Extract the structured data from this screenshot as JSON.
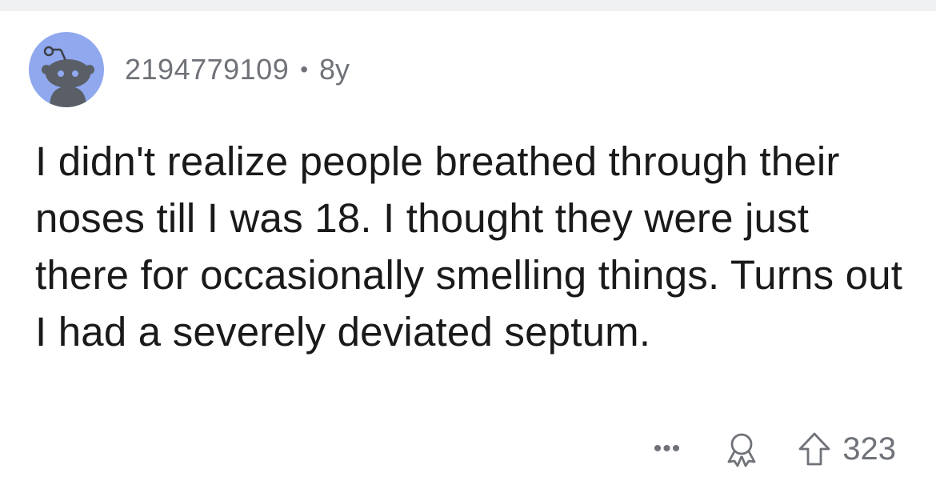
{
  "comment": {
    "username": "2194779109",
    "separator": "•",
    "age": "8y",
    "text": "I didn't realize people breathed through their noses till I was 18. I thought they were just there for occasionally smelling things. Turns out I had a severely deviated septum.",
    "score": "323"
  },
  "actions": {
    "more_label": "•••"
  },
  "icons": {
    "avatar": "snoo-avatar-icon",
    "more": "more-options-icon",
    "award": "award-icon",
    "upvote": "upvote-arrow-icon"
  },
  "colors": {
    "avatar_bg": "#8fa8ee",
    "meta_text": "#6f7278",
    "body_text": "#1a1a1b",
    "top_strip": "#eef0f2"
  }
}
